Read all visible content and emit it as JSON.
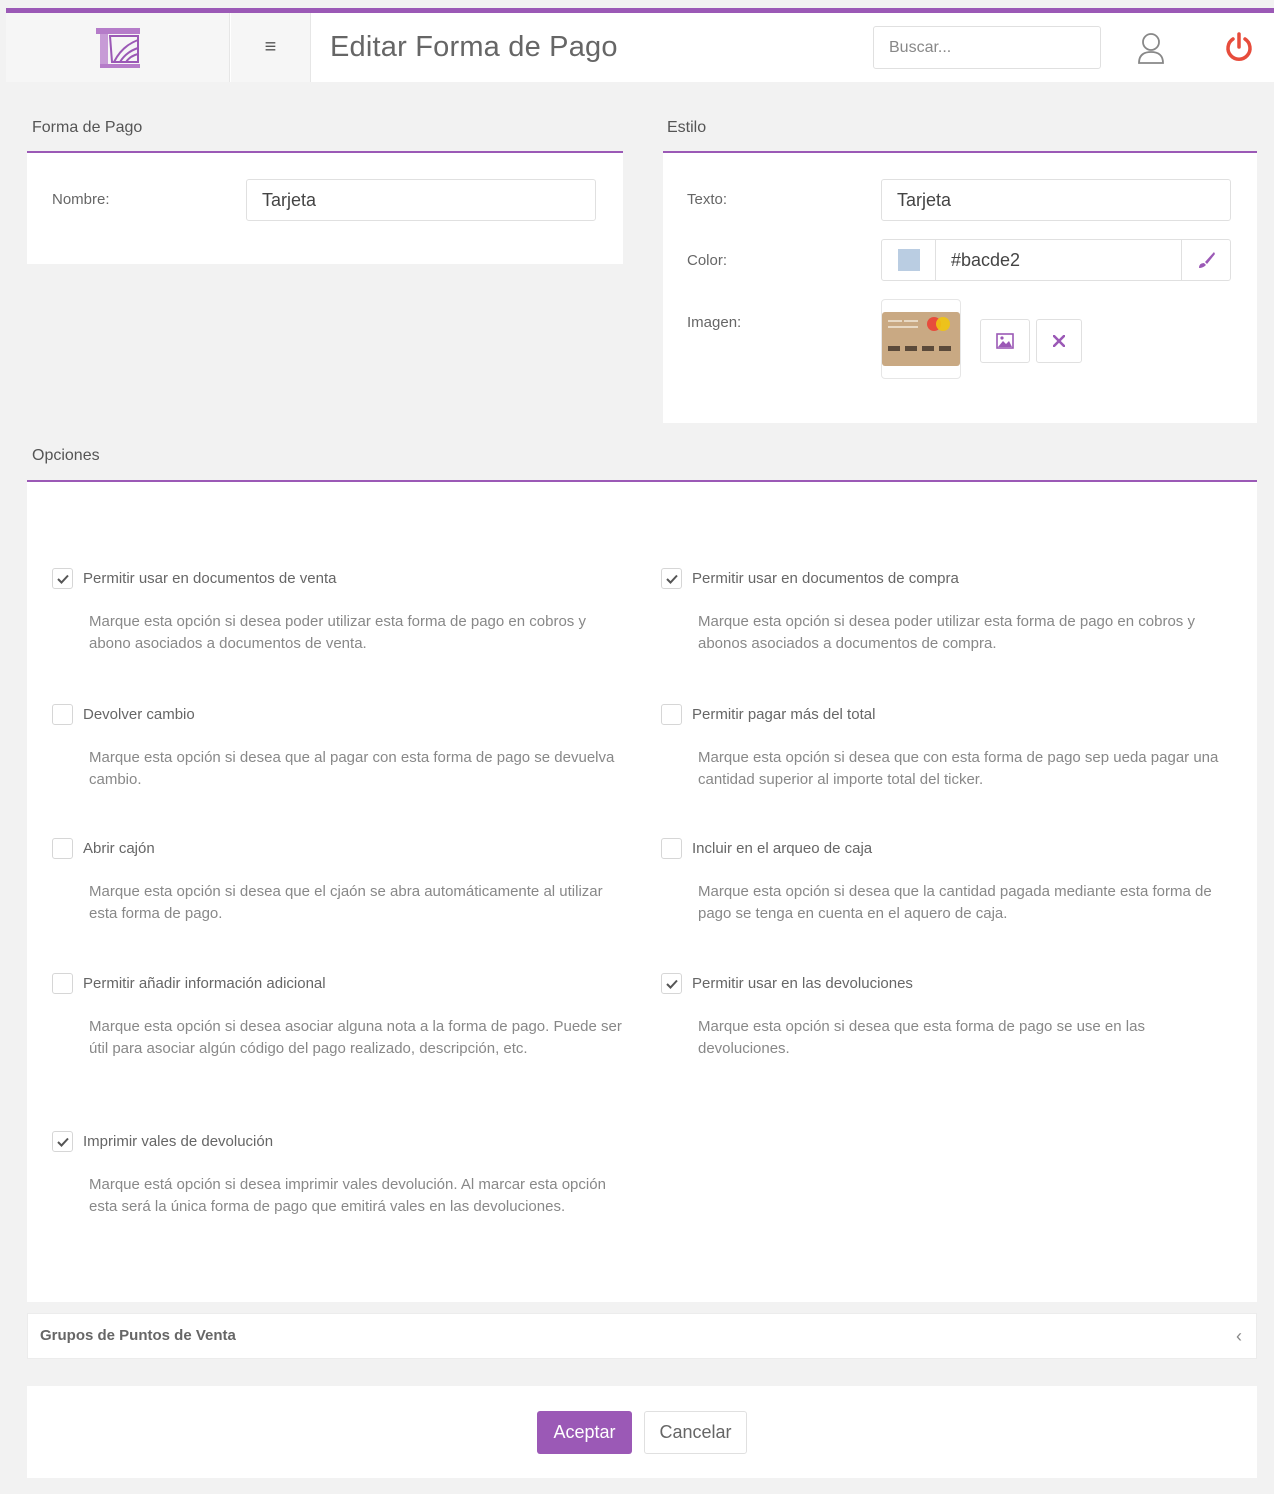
{
  "header": {
    "title": "Editar Forma de Pago",
    "search_placeholder": "Buscar..."
  },
  "colors": {
    "accent": "#9b59b6",
    "power": "#e74c3c"
  },
  "forma_de_pago": {
    "title": "Forma de Pago",
    "nombre_label": "Nombre:",
    "nombre_value": "Tarjeta"
  },
  "estilo": {
    "title": "Estilo",
    "texto_label": "Texto:",
    "texto_value": "Tarjeta",
    "color_label": "Color:",
    "color_value": "#bacde2",
    "imagen_label": "Imagen:"
  },
  "opciones": {
    "title": "Opciones",
    "items": [
      {
        "label": "Permitir usar en documentos de venta",
        "checked": true,
        "desc": "Marque esta opción si desea poder utilizar esta forma de pago en cobros y abono asociados a documentos de venta."
      },
      {
        "label": "Permitir usar en documentos de compra",
        "checked": true,
        "desc": "Marque esta opción si desea poder utilizar esta forma de pago en cobros y abonos asociados a documentos de compra."
      },
      {
        "label": "Devolver cambio",
        "checked": false,
        "desc": "Marque esta opción si desea que al pagar con esta forma de pago se devuelva cambio."
      },
      {
        "label": "Permitir pagar más del total",
        "checked": false,
        "desc": "Marque esta opción si desea que con esta forma de pago sep ueda pagar una cantidad superior al importe total del ticker."
      },
      {
        "label": "Abrir cajón",
        "checked": false,
        "desc": "Marque esta opción si desea que el cjaón se abra automáticamente al utilizar esta forma de pago."
      },
      {
        "label": "Incluir en el arqueo de caja",
        "checked": false,
        "desc": "Marque esta opción si desea que la cantidad pagada mediante esta forma de pago se tenga en cuenta en el aquero de caja."
      },
      {
        "label": "Permitir añadir información adicional",
        "checked": false,
        "desc": "Marque esta opción si desea asociar alguna nota a la forma de pago. Puede ser útil para asociar algún código del pago realizado, descripción, etc."
      },
      {
        "label": "Permitir usar en las devoluciones",
        "checked": true,
        "desc": "Marque esta opción si desea que esta forma de pago se use en las devoluciones."
      },
      {
        "label": "Imprimir vales de devolución",
        "checked": true,
        "desc": "Marque está opción si desea imprimir vales devolución. Al marcar esta opción esta será la única forma de pago que emitirá vales en las devoluciones."
      }
    ]
  },
  "grupos": {
    "title": "Grupos de Puntos de Venta"
  },
  "footer": {
    "accept_label": "Aceptar",
    "cancel_label": "Cancelar"
  }
}
